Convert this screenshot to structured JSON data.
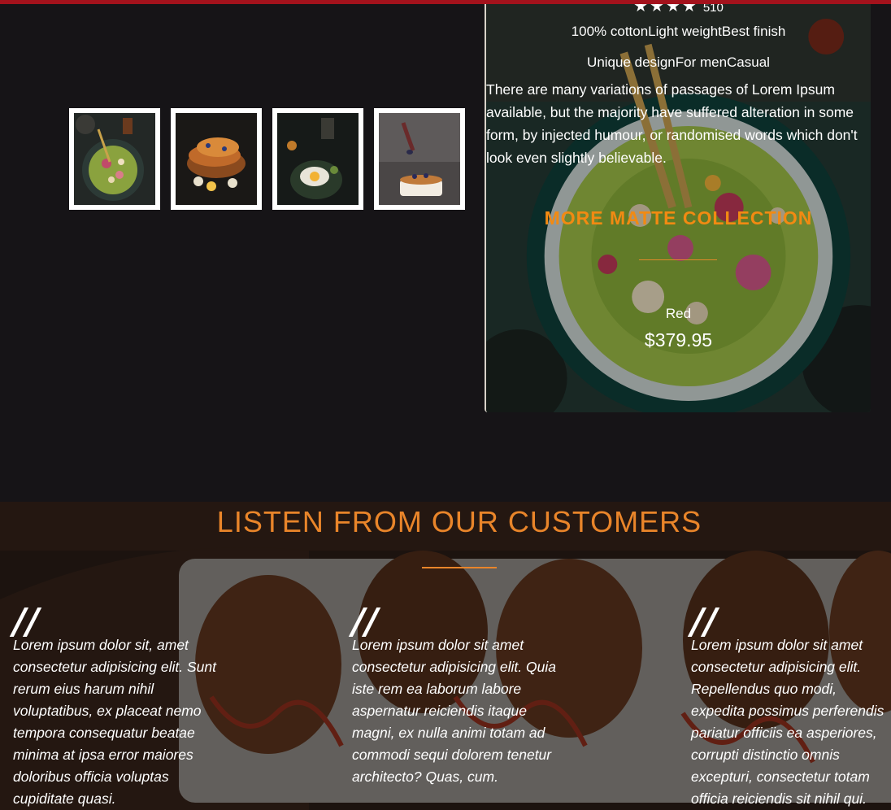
{
  "product": {
    "rating_stars": "★★★★",
    "rating_count": "510",
    "features_line1": "100% cottonLight weightBest finish",
    "features_line2": "Unique designFor menCasual",
    "description": "There are many variations of passages of Lorem Ipsum available, but the majority have suffered alteration in some form, by injected humour, or randomised words which don't look even slightly believable.",
    "more_link": "MORE MATTE COLLECTION",
    "color": "Red",
    "price": "$379.95"
  },
  "thumbnails": [
    {
      "icon": "salad-bowl-image"
    },
    {
      "icon": "french-toast-image"
    },
    {
      "icon": "egg-plate-image"
    },
    {
      "icon": "dessert-image"
    }
  ],
  "testimonials": {
    "title": "LISTEN FROM OUR CUSTOMERS",
    "quote_mark": "”",
    "items": [
      {
        "text": "Lorem ipsum dolor sit, amet consectetur adipisicing elit. Sunt rerum eius harum nihil voluptatibus, ex placeat nemo tempora consequatur beatae minima at ipsa error maiores doloribus officia voluptas cupiditate quasi."
      },
      {
        "text": "Lorem ipsum dolor sit amet consectetur adipisicing elit. Quia iste rem ea laborum labore aspernatur reiciendis itaque magni, ex nulla animi totam ad commodi sequi dolorem tenetur architecto? Quas, cum."
      },
      {
        "text": "Lorem ipsum dolor sit amet consectetur adipisicing elit. Repellendus quo modi, expedita possimus perferendis pariatur officiis ea asperiores, corrupti distinctio omnis excepturi, consectetur totam officia reiciendis sit nihil qui."
      }
    ]
  },
  "colors": {
    "accent": "#f28a12",
    "top_bar": "#a3121c",
    "background": "#161417"
  }
}
